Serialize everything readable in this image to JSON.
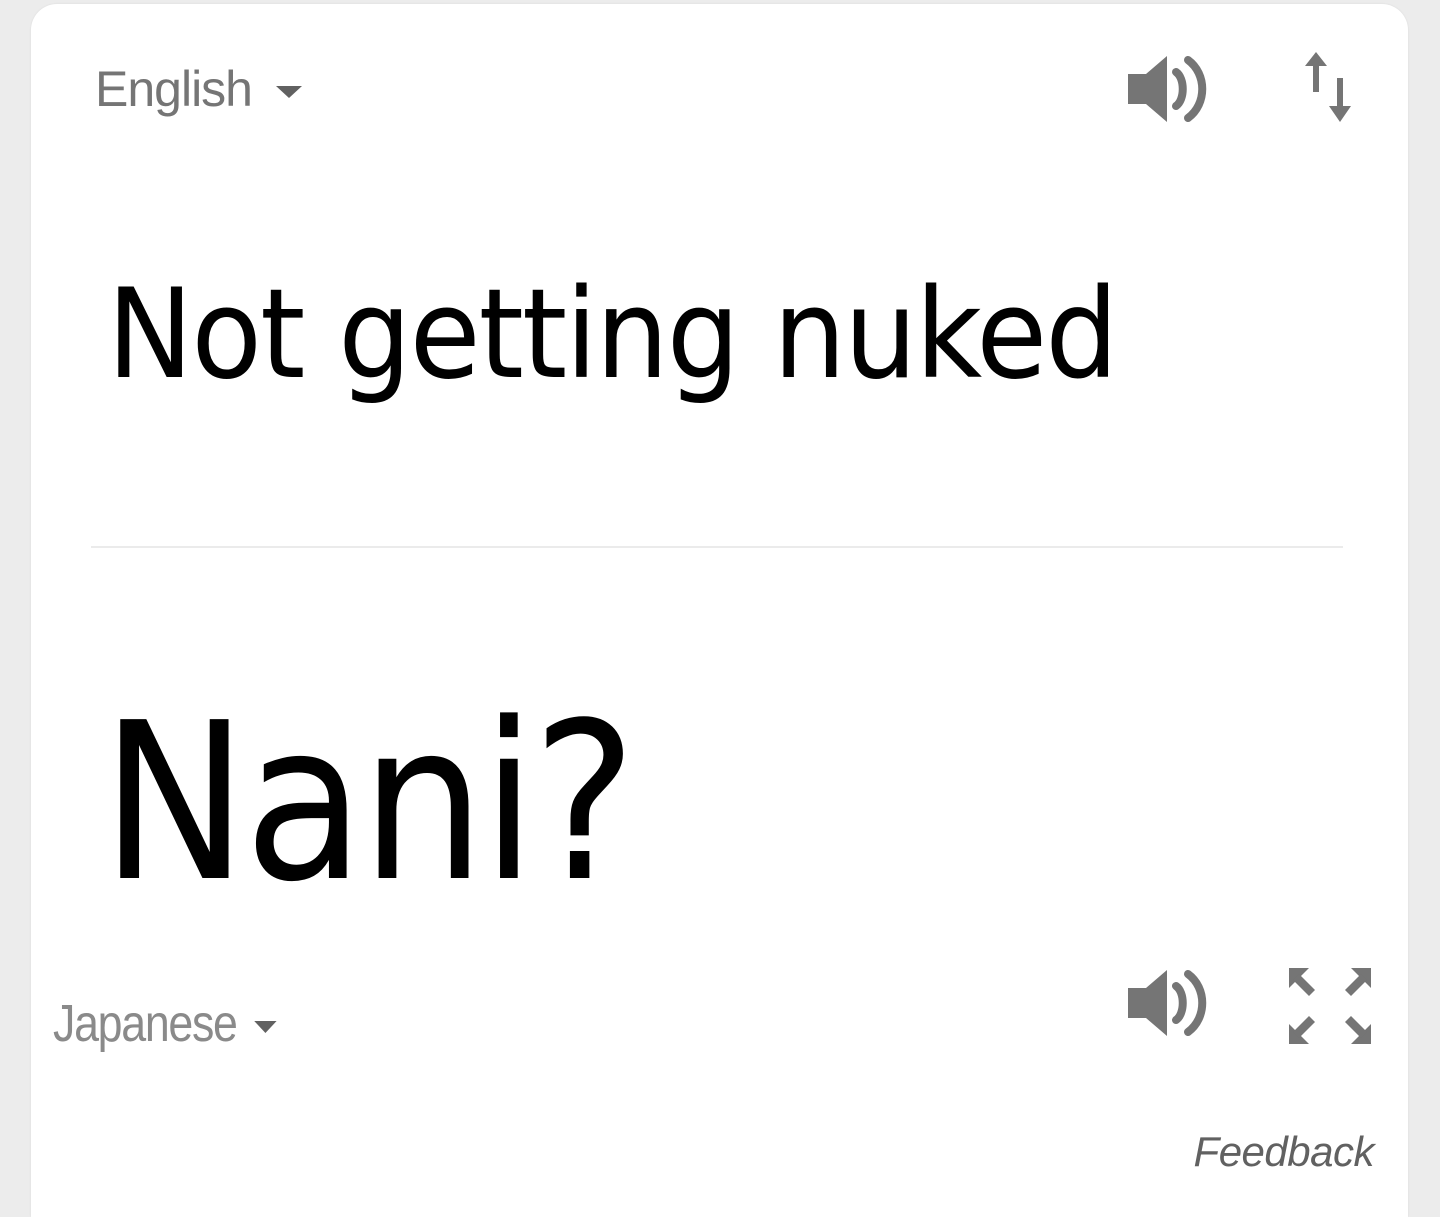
{
  "source": {
    "language": "English",
    "text": "Not getting nuked"
  },
  "target": {
    "language": "Japanese",
    "text": "Nani?"
  },
  "footer": {
    "feedback_label": "Feedback"
  },
  "icons": {
    "speaker": "speaker-icon",
    "swap": "swap-languages-icon",
    "expand": "fullscreen-icon",
    "dropdown": "chevron-down-icon"
  },
  "colors": {
    "icon": "#757575",
    "text": "#000000",
    "muted": "#757575"
  }
}
